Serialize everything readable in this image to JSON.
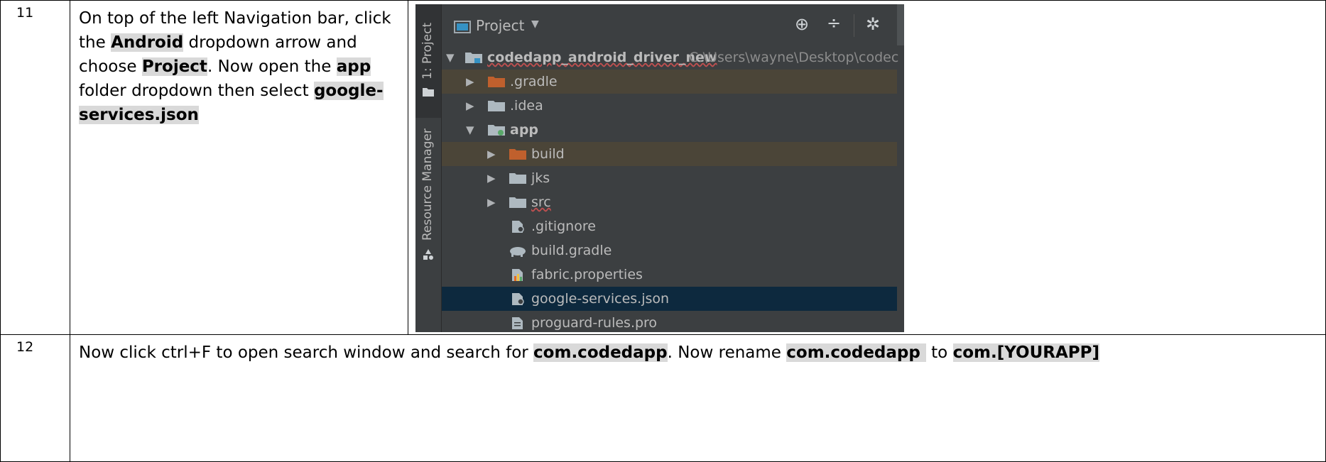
{
  "rows": [
    {
      "number": "11",
      "instruction": [
        {
          "t": "On top of the left Navigation bar, click the ",
          "b": false
        },
        {
          "t": "Android",
          "b": true
        },
        {
          "t": " dropdown arrow and choose ",
          "b": false
        },
        {
          "t": "Project",
          "b": true
        },
        {
          "t": ". Now open the ",
          "b": false
        },
        {
          "t": "app",
          "b": true
        },
        {
          "t": " folder dropdown then select ",
          "b": false
        },
        {
          "t": "google-services.json",
          "b": true
        }
      ]
    },
    {
      "number": "12",
      "instruction": [
        {
          "t": "Now click ctrl+F to open search window and search for ",
          "b": false
        },
        {
          "t": "com.codedapp",
          "b": true
        },
        {
          "t": ". Now rename ",
          "b": false
        },
        {
          "t": "com.codedapp ",
          "b": true
        },
        {
          "t": " to ",
          "b": false
        },
        {
          "t": "com.[YOURAPP]",
          "b": true
        }
      ]
    }
  ],
  "ide": {
    "view_selector": "Project",
    "side_tabs": [
      "1: Project",
      "Resource Manager"
    ],
    "project_name": "codedapp_android_driver_new",
    "project_path": "C:\\Users\\wayne\\Desktop\\codec",
    "tree": [
      {
        "label": ".gradle",
        "level": 1,
        "icon": "orange-folder-icon",
        "arrow": "collapsed",
        "state": "excluded"
      },
      {
        "label": ".idea",
        "level": 1,
        "icon": "folder-icon",
        "arrow": "collapsed",
        "state": "normal"
      },
      {
        "label": "app",
        "level": 1,
        "icon": "module-folder-icon",
        "arrow": "expanded",
        "state": "normal",
        "bold": true
      },
      {
        "label": "build",
        "level": 2,
        "icon": "orange-folder-icon",
        "arrow": "collapsed",
        "state": "excluded"
      },
      {
        "label": "jks",
        "level": 2,
        "icon": "folder-icon",
        "arrow": "collapsed",
        "state": "normal"
      },
      {
        "label": "src",
        "level": 2,
        "icon": "folder-icon",
        "arrow": "collapsed",
        "state": "normal"
      },
      {
        "label": ".gitignore",
        "level": 2,
        "icon": "ignore-file-icon",
        "arrow": "none",
        "state": "normal"
      },
      {
        "label": "build.gradle",
        "level": 2,
        "icon": "gradle-elephant-icon",
        "arrow": "none",
        "state": "normal"
      },
      {
        "label": "fabric.properties",
        "level": 2,
        "icon": "properties-file-icon",
        "arrow": "none",
        "state": "normal"
      },
      {
        "label": "google-services.json",
        "level": 2,
        "icon": "json-file-icon",
        "arrow": "none",
        "state": "selected"
      },
      {
        "label": "proguard-rules.pro",
        "level": 2,
        "icon": "text-file-icon",
        "arrow": "none",
        "state": "normal"
      }
    ],
    "colors": {
      "background": "#3c3f41",
      "excluded": "#4b4538",
      "selected": "#0d293e",
      "text": "#bbbbbb",
      "orange_folder": "#c0602d",
      "folder": "#aeb9c0"
    }
  }
}
